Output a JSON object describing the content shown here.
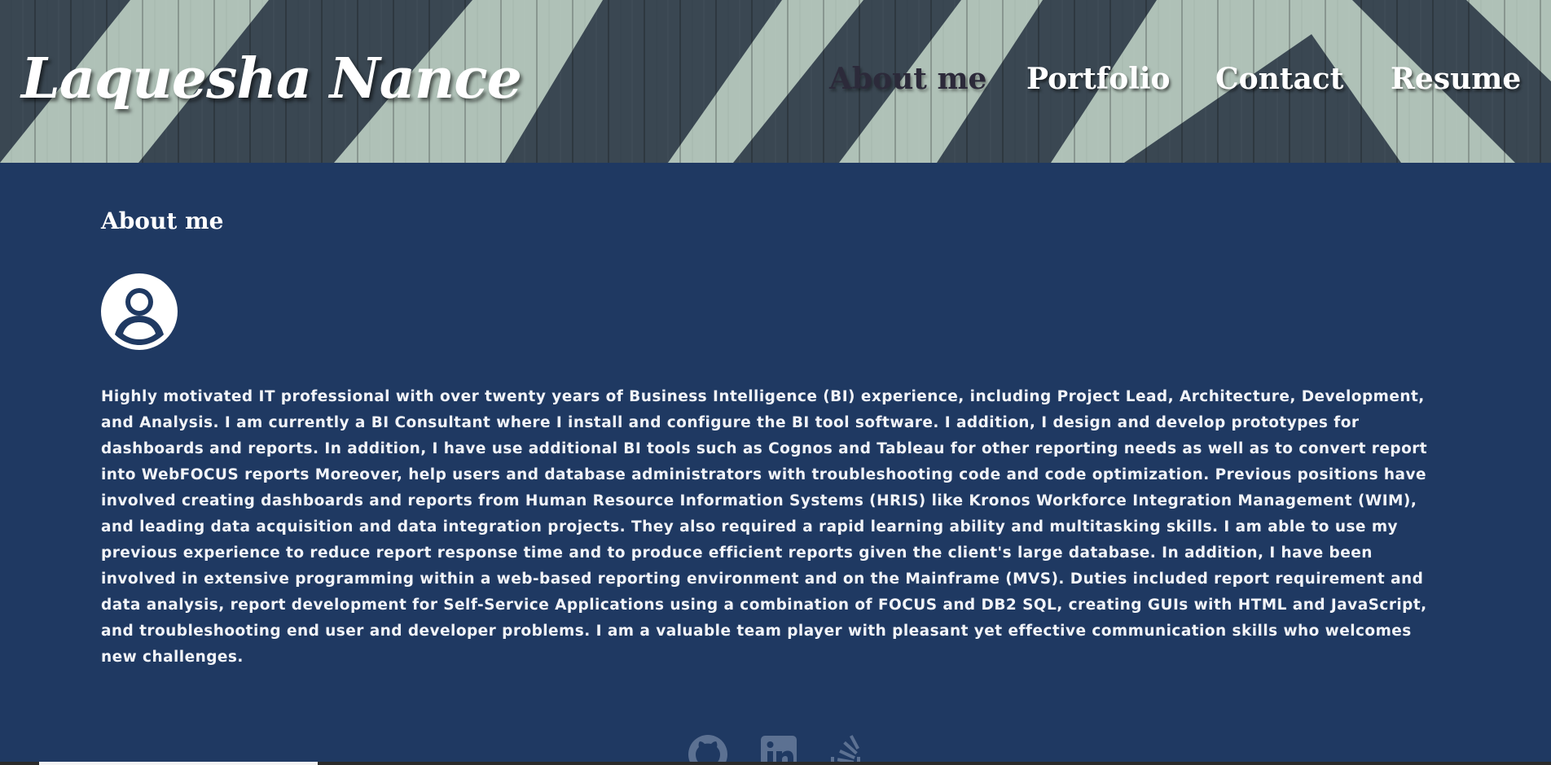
{
  "header": {
    "site_title": "Laquesha Nance",
    "nav": [
      {
        "label": "About me",
        "active": true
      },
      {
        "label": "Portfolio",
        "active": false
      },
      {
        "label": "Contact",
        "active": false
      },
      {
        "label": "Resume",
        "active": false
      }
    ]
  },
  "about": {
    "title": "About me",
    "avatar_icon": "user-circle-icon",
    "bio": "Highly motivated IT professional with over twenty years of Business Intelligence (BI) experience, including Project Lead, Architecture, Development, and Analysis. I am currently a BI Consultant where I install and configure the BI tool software. I addition, I design and develop prototypes for dashboards and reports. In addition, I have use additional BI tools such as Cognos and Tableau for other reporting needs as well as to convert report into WebFOCUS reports Moreover, help users and database administrators with troubleshooting code and code optimization. Previous positions have involved creating dashboards and reports from Human Resource Information Systems (HRIS) like Kronos Workforce Integration Management (WIM), and leading data acquisition and data integration projects. They also required a rapid learning ability and multitasking skills. I am able to use my previous experience to reduce report response time and to produce efficient reports given the client's large database. In addition, I have been involved in extensive programming within a web-based reporting environment and on the Mainframe (MVS). Duties included report requirement and data analysis, report development for Self-Service Applications using a combination of FOCUS and DB2 SQL, creating GUIs with HTML and JavaScript, and troubleshooting end user and developer problems. I am a valuable team player with pleasant yet effective communication skills who welcomes new challenges."
  },
  "social": {
    "icons": [
      "github-icon",
      "linkedin-icon",
      "stack-overflow-icon"
    ]
  },
  "colors": {
    "main_background": "#1f3962",
    "fence_light": "#bcd0c4",
    "fence_dark": "#3c4a55",
    "nav_active": "#2c2a3a",
    "text": "#ffffff",
    "social_icon": "#5c7192"
  }
}
